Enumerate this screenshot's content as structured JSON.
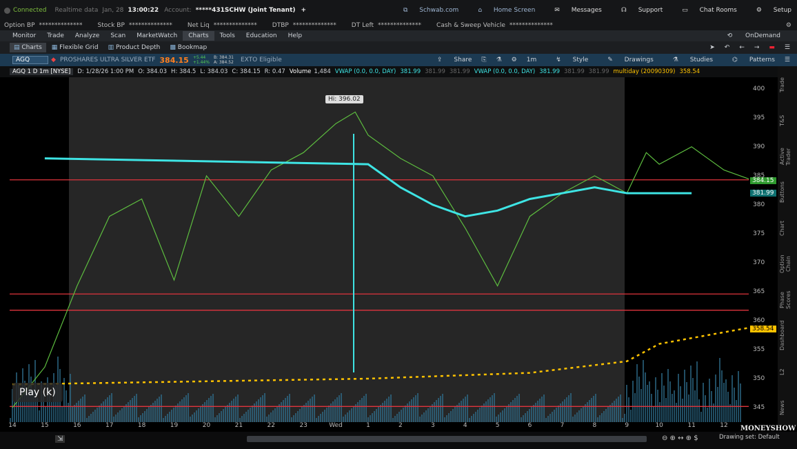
{
  "top": {
    "status": "Connected",
    "feed": "Realtime data",
    "date": "Jan, 28",
    "time": "13:00:22",
    "account_label": "Account:",
    "account": "*****431SCHW (Joint Tenant)",
    "plus": "+",
    "links": [
      {
        "label": "Schwab.com",
        "icon": "external-link-icon"
      },
      {
        "label": "Home Screen",
        "icon": "home-screen-icon"
      },
      {
        "label": "Messages",
        "icon": "mail-icon"
      },
      {
        "label": "Support",
        "icon": "headset-icon"
      },
      {
        "label": "Chat Rooms",
        "icon": "chat-icon"
      },
      {
        "label": "Setup",
        "icon": "gear-icon"
      }
    ]
  },
  "balances": [
    {
      "label": "Option BP",
      "value": "**************"
    },
    {
      "label": "Stock BP",
      "value": "**************"
    },
    {
      "label": "Net Liq",
      "value": "**************"
    },
    {
      "label": "DTBP",
      "value": "**************"
    },
    {
      "label": "DT Left",
      "value": "**************"
    },
    {
      "label": "Cash & Sweep Vehicle",
      "value": "**************"
    }
  ],
  "menu": {
    "items": [
      "Monitor",
      "Trade",
      "Analyze",
      "Scan",
      "MarketWatch",
      "Charts",
      "Tools",
      "Education",
      "Help"
    ],
    "active": "Charts",
    "ondemand": "OnDemand"
  },
  "subtabs": [
    "Charts",
    "Flexible Grid",
    "Product Depth",
    "Bookmap"
  ],
  "symbolbar": {
    "symbol": "AGQ",
    "name": "PROSHARES ULTRA SILVER ETF",
    "price": "384.15",
    "change_top": "+5.44",
    "change_bot": "+1.44%",
    "bid": "B: 384.31",
    "ask": "A: 384.52",
    "extra": "EXTO Eligible",
    "tools": [
      "Share",
      "Style",
      "Drawings",
      "Studies",
      "Patterns"
    ],
    "interval": "1m"
  },
  "infobar": {
    "study": "AGQ 1 D 1m [NYSE]",
    "date": "D: 1/28/26 1:00 PM",
    "open": "O: 384.03",
    "high": "H: 384.5",
    "low": "L: 384.03",
    "close": "C: 384.15",
    "range": "R: 0.47",
    "volume_label": "Volume",
    "volume": "1,484",
    "vwap1": "VWAP (0.0, 0.0, DAY)",
    "vwap1_val": "381.99",
    "vwap1_a": "381.99",
    "vwap1_b": "381.99",
    "vwap2": "VWAP (0.0, 0.0, DAY)",
    "vwap2_val": "381.99",
    "vwap2_a": "381.99",
    "vwap2_b": "381.99",
    "multiday": "multiday (20090309)",
    "multiday_val": "358.54"
  },
  "colors": {
    "bull": "#5dbd3f",
    "bear": "#d6454a",
    "vwap": "#3ee4e4",
    "multiday": "#ffc300",
    "level": "#e0343d"
  },
  "chart_data": {
    "type": "line",
    "y_ticks": [
      "400",
      "395",
      "390",
      "385",
      "380",
      "375",
      "370",
      "365",
      "360",
      "355",
      "350",
      "345"
    ],
    "y_range": [
      342.5,
      402
    ],
    "x_ticks": [
      "14",
      "15",
      "16",
      "17",
      "18",
      "19",
      "20",
      "21",
      "22",
      "23",
      "Wed",
      "1",
      "2",
      "3",
      "4",
      "5",
      "6",
      "7",
      "8",
      "9",
      "10",
      "11",
      "12"
    ],
    "hi_label": "Hi: 396.02",
    "horizontal_levels": [
      384.3,
      364.6,
      361.8,
      345.2
    ],
    "last_price": "384.15",
    "vwap_last": "381.99",
    "multiday_last": "358.54",
    "price_path": [
      [
        0,
        345
      ],
      [
        1,
        352
      ],
      [
        2,
        366
      ],
      [
        3,
        378
      ],
      [
        4,
        381
      ],
      [
        5,
        367
      ],
      [
        6,
        385
      ],
      [
        7,
        378
      ],
      [
        8,
        386
      ],
      [
        9,
        389
      ],
      [
        10,
        394
      ],
      [
        10.6,
        396
      ],
      [
        11,
        392
      ],
      [
        12,
        388
      ],
      [
        13,
        385
      ],
      [
        14,
        376
      ],
      [
        15,
        366
      ],
      [
        16,
        378
      ],
      [
        17,
        382
      ],
      [
        18,
        385
      ],
      [
        19,
        382
      ],
      [
        19.6,
        389
      ],
      [
        20,
        387
      ],
      [
        21,
        390
      ],
      [
        22,
        386
      ],
      [
        23,
        384
      ],
      [
        24,
        389
      ]
    ],
    "vwap_path": [
      [
        1,
        388
      ],
      [
        11,
        387
      ],
      [
        12,
        383
      ],
      [
        13,
        380
      ],
      [
        14,
        378
      ],
      [
        15,
        379
      ],
      [
        16,
        381
      ],
      [
        17,
        382
      ],
      [
        18,
        383
      ],
      [
        19,
        382
      ],
      [
        20,
        382
      ],
      [
        21,
        382
      ]
    ],
    "multiday_path": [
      [
        0,
        349
      ],
      [
        11,
        350
      ],
      [
        16,
        351
      ],
      [
        19,
        353
      ],
      [
        20,
        356
      ],
      [
        23,
        359
      ]
    ]
  },
  "side_tabs": [
    "Trade",
    "T&S",
    "Active Trader",
    "Buttons",
    "Chart",
    "Option Chain",
    "Phase Scores",
    "Dashboard",
    "L2",
    "News"
  ],
  "overlay": {
    "play": "Play (k)",
    "logo": "MONEYSHOW",
    "drawing_set": "Drawing set: Default"
  }
}
